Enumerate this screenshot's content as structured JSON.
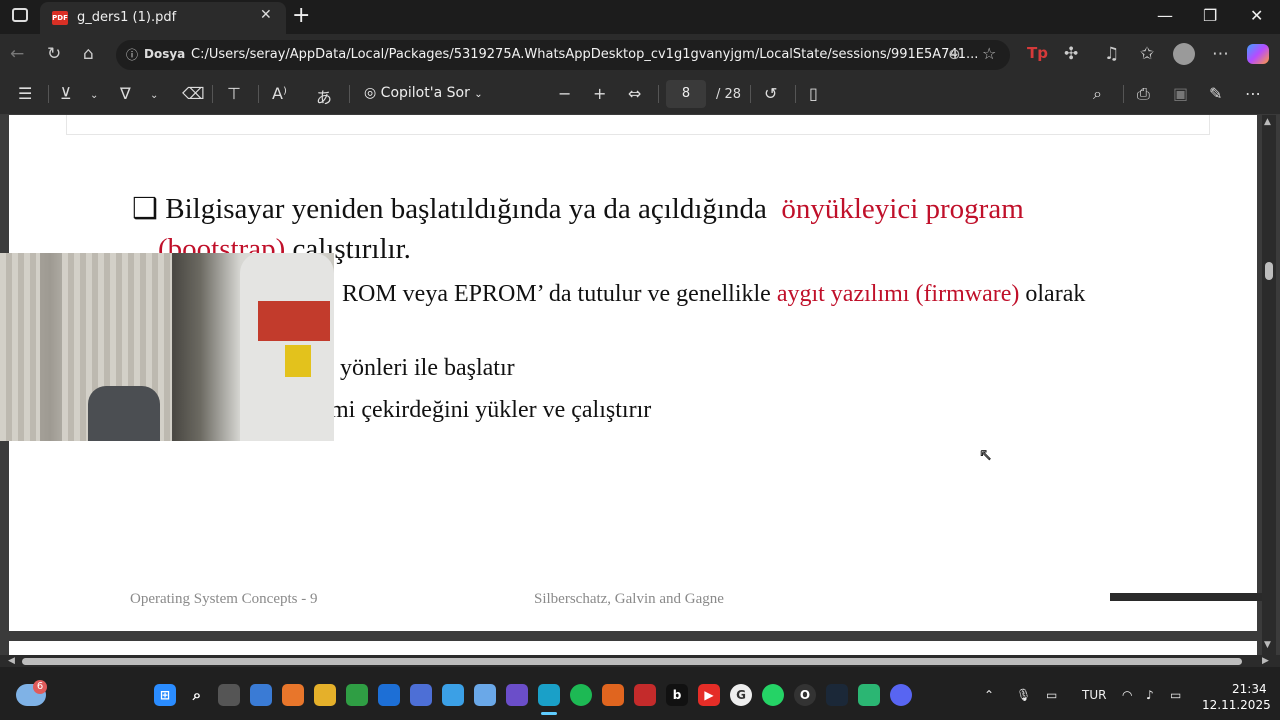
{
  "browser": {
    "tab_title": "g_ders1 (1).pdf",
    "tab_badge": "PDF",
    "address_label": "Dosya",
    "url": "C:/Users/seray/AppData/Local/Packages/5319275A.WhatsAppDesktop_cv1g1gvanyjgm/LocalState/sessions/991E5A741..."
  },
  "pdf_toolbar": {
    "copilot_label": "Copilot'a Sor",
    "page_current": "8",
    "page_total": "/ 28"
  },
  "document": {
    "bullet1_prefix": "Bilgisayar yeniden başlatıldığında ya da açıldığında",
    "bullet1_red": "önyükleyici program",
    "line2_red": "(bootstrap)",
    "line2_rest": " çalıştırılır.",
    "line3_pre": "ROM veya EPROM’ da tutulur ve genellikle ",
    "line3_red": "aygıt yazılımı (firmware)",
    "line3_post": " olarak",
    "line4": "yönleri ile başlatır",
    "line5": "mi çekirdeğini yükler ve çalıştırır",
    "footer_left": "Operating System Concepts - 9",
    "footer_center": "Silberschatz, Galvin and Gagne"
  },
  "taskbar": {
    "weather_badge": "6",
    "language": "TUR",
    "time": "21:34",
    "date": "12.11.2025"
  },
  "colors": {
    "accent_red": "#c0102a",
    "taskbar_bg": "#202020"
  }
}
